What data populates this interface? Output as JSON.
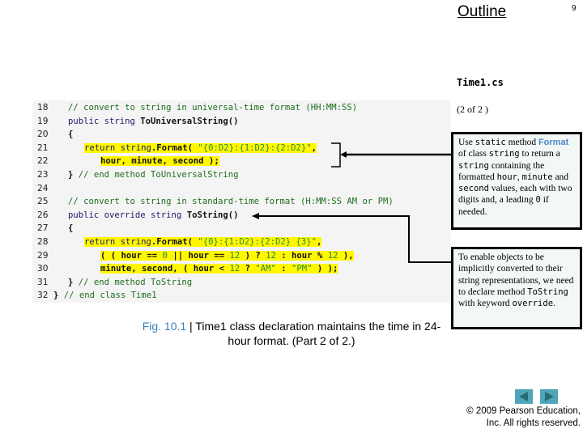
{
  "header": {
    "outline_label": "Outline",
    "page_number": "9",
    "file_name": "Time1.cs",
    "part_label": "(2 of 2 )"
  },
  "code": {
    "lines": [
      {
        "num": "18",
        "indent": 1,
        "segments": [
          {
            "t": "// convert to string in universal-time format (HH:MM:SS)",
            "c": "cm"
          }
        ]
      },
      {
        "num": "19",
        "indent": 1,
        "segments": [
          {
            "t": "public string ",
            "c": "kw"
          },
          {
            "t": "ToUniversalString()",
            "c": "tx"
          }
        ]
      },
      {
        "num": "20",
        "indent": 1,
        "segments": [
          {
            "t": "{",
            "c": "tx"
          }
        ]
      },
      {
        "num": "21",
        "indent": 2,
        "hl": true,
        "segments": [
          {
            "t": "return string",
            "c": "kw"
          },
          {
            "t": ".Format( ",
            "c": "tx"
          },
          {
            "t": "\"{0:D2}:{1:D2}:{2:D2}\"",
            "c": "st"
          },
          {
            "t": ",",
            "c": "tx"
          }
        ]
      },
      {
        "num": "22",
        "indent": 3,
        "hl": true,
        "segments": [
          {
            "t": "hour, minute, second );",
            "c": "tx"
          }
        ]
      },
      {
        "num": "23",
        "indent": 1,
        "segments": [
          {
            "t": "} ",
            "c": "tx"
          },
          {
            "t": "// end method ToUniversalString",
            "c": "cm"
          }
        ]
      },
      {
        "num": "24",
        "indent": 0,
        "segments": []
      },
      {
        "num": "25",
        "indent": 1,
        "segments": [
          {
            "t": "// convert to string in standard-time format (H:MM:SS AM or PM)",
            "c": "cm"
          }
        ]
      },
      {
        "num": "26",
        "indent": 1,
        "segments": [
          {
            "t": "public override string ",
            "c": "kw"
          },
          {
            "t": "ToString()",
            "c": "tx"
          }
        ]
      },
      {
        "num": "27",
        "indent": 1,
        "segments": [
          {
            "t": "{",
            "c": "tx"
          }
        ]
      },
      {
        "num": "28",
        "indent": 2,
        "hl": true,
        "segments": [
          {
            "t": "return string",
            "c": "kw"
          },
          {
            "t": ".Format( ",
            "c": "tx"
          },
          {
            "t": "\"{0}:{1:D2}:{2:D2} {3}\"",
            "c": "st"
          },
          {
            "t": ",",
            "c": "tx"
          }
        ]
      },
      {
        "num": "29",
        "indent": 3,
        "hl": true,
        "segments": [
          {
            "t": "( ( hour == ",
            "c": "tx"
          },
          {
            "t": "0",
            "c": "st"
          },
          {
            "t": " || hour == ",
            "c": "tx"
          },
          {
            "t": "12",
            "c": "st"
          },
          {
            "t": " ) ? ",
            "c": "tx"
          },
          {
            "t": "12",
            "c": "st"
          },
          {
            "t": " : hour % ",
            "c": "tx"
          },
          {
            "t": "12",
            "c": "st"
          },
          {
            "t": " ),",
            "c": "tx"
          }
        ]
      },
      {
        "num": "30",
        "indent": 3,
        "hl": true,
        "segments": [
          {
            "t": "minute, second, ( hour < ",
            "c": "tx"
          },
          {
            "t": "12",
            "c": "st"
          },
          {
            "t": " ? ",
            "c": "tx"
          },
          {
            "t": "\"AM\"",
            "c": "st"
          },
          {
            "t": " : ",
            "c": "tx"
          },
          {
            "t": "\"PM\"",
            "c": "st"
          },
          {
            "t": " ) );",
            "c": "tx"
          }
        ]
      },
      {
        "num": "31",
        "indent": 1,
        "segments": [
          {
            "t": "} ",
            "c": "tx"
          },
          {
            "t": "// end method ToString",
            "c": "cm"
          }
        ]
      },
      {
        "num": "32",
        "indent": 0,
        "segments": [
          {
            "t": "} ",
            "c": "tx"
          },
          {
            "t": "// end class Time1",
            "c": "cm"
          }
        ]
      }
    ]
  },
  "callouts": [
    {
      "segments": [
        {
          "t": "Use ",
          "c": ""
        },
        {
          "t": "static",
          "c": "mono"
        },
        {
          "t": " method ",
          "c": ""
        },
        {
          "t": "Format",
          "c": "fmt"
        },
        {
          "t": " of class ",
          "c": ""
        },
        {
          "t": "string",
          "c": "mono"
        },
        {
          "t": " to return a ",
          "c": ""
        },
        {
          "t": "string",
          "c": "mono"
        },
        {
          "t": " containing the formatted ",
          "c": ""
        },
        {
          "t": "hour",
          "c": "mono"
        },
        {
          "t": ", ",
          "c": ""
        },
        {
          "t": "minute",
          "c": "mono"
        },
        {
          "t": " and ",
          "c": ""
        },
        {
          "t": "second",
          "c": "mono"
        },
        {
          "t": " values, each with two digits and, a leading ",
          "c": ""
        },
        {
          "t": "0",
          "c": "mono"
        },
        {
          "t": " if needed.",
          "c": ""
        }
      ]
    },
    {
      "segments": [
        {
          "t": "To enable objects to be implicitly converted to their string representations, we need to declare method ",
          "c": ""
        },
        {
          "t": "ToString",
          "c": "mono"
        },
        {
          "t": " with keyword ",
          "c": ""
        },
        {
          "t": "override",
          "c": "mono"
        },
        {
          "t": ".",
          "c": ""
        }
      ]
    }
  ],
  "caption": {
    "fig_label": "Fig. 10.1",
    "separator": " | ",
    "text": "Time1 class declaration maintains the time in 24-hour format. (Part 2 of 2.)"
  },
  "navigation": {
    "prev_icon": "triangle-left-icon",
    "next_icon": "triangle-right-icon",
    "color": "#4fa6b8"
  },
  "footer": {
    "copyright_line1": "© 2009 Pearson Education,",
    "copyright_line2": "Inc.  All rights reserved."
  }
}
